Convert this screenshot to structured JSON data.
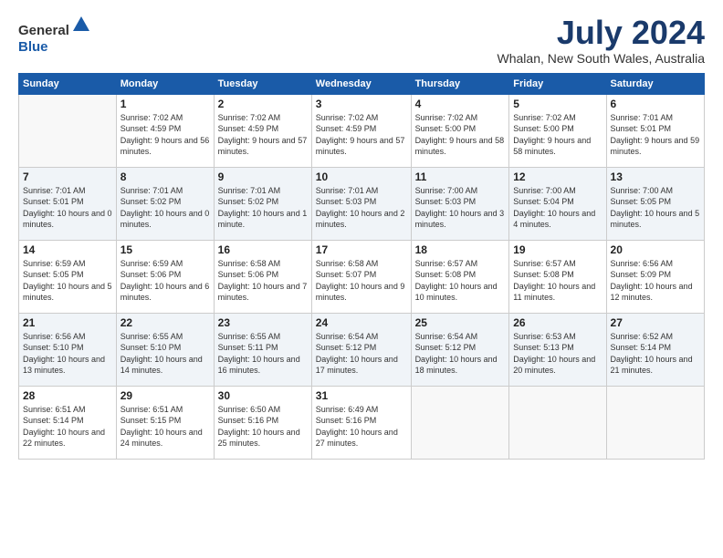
{
  "logo": {
    "general": "General",
    "blue": "Blue"
  },
  "title": "July 2024",
  "location": "Whalan, New South Wales, Australia",
  "weekdays": [
    "Sunday",
    "Monday",
    "Tuesday",
    "Wednesday",
    "Thursday",
    "Friday",
    "Saturday"
  ],
  "weeks": [
    [
      {
        "day": "",
        "sunrise": "",
        "sunset": "",
        "daylight": ""
      },
      {
        "day": "1",
        "sunrise": "Sunrise: 7:02 AM",
        "sunset": "Sunset: 4:59 PM",
        "daylight": "Daylight: 9 hours and 56 minutes."
      },
      {
        "day": "2",
        "sunrise": "Sunrise: 7:02 AM",
        "sunset": "Sunset: 4:59 PM",
        "daylight": "Daylight: 9 hours and 57 minutes."
      },
      {
        "day": "3",
        "sunrise": "Sunrise: 7:02 AM",
        "sunset": "Sunset: 4:59 PM",
        "daylight": "Daylight: 9 hours and 57 minutes."
      },
      {
        "day": "4",
        "sunrise": "Sunrise: 7:02 AM",
        "sunset": "Sunset: 5:00 PM",
        "daylight": "Daylight: 9 hours and 58 minutes."
      },
      {
        "day": "5",
        "sunrise": "Sunrise: 7:02 AM",
        "sunset": "Sunset: 5:00 PM",
        "daylight": "Daylight: 9 hours and 58 minutes."
      },
      {
        "day": "6",
        "sunrise": "Sunrise: 7:01 AM",
        "sunset": "Sunset: 5:01 PM",
        "daylight": "Daylight: 9 hours and 59 minutes."
      }
    ],
    [
      {
        "day": "7",
        "sunrise": "Sunrise: 7:01 AM",
        "sunset": "Sunset: 5:01 PM",
        "daylight": "Daylight: 10 hours and 0 minutes."
      },
      {
        "day": "8",
        "sunrise": "Sunrise: 7:01 AM",
        "sunset": "Sunset: 5:02 PM",
        "daylight": "Daylight: 10 hours and 0 minutes."
      },
      {
        "day": "9",
        "sunrise": "Sunrise: 7:01 AM",
        "sunset": "Sunset: 5:02 PM",
        "daylight": "Daylight: 10 hours and 1 minute."
      },
      {
        "day": "10",
        "sunrise": "Sunrise: 7:01 AM",
        "sunset": "Sunset: 5:03 PM",
        "daylight": "Daylight: 10 hours and 2 minutes."
      },
      {
        "day": "11",
        "sunrise": "Sunrise: 7:00 AM",
        "sunset": "Sunset: 5:03 PM",
        "daylight": "Daylight: 10 hours and 3 minutes."
      },
      {
        "day": "12",
        "sunrise": "Sunrise: 7:00 AM",
        "sunset": "Sunset: 5:04 PM",
        "daylight": "Daylight: 10 hours and 4 minutes."
      },
      {
        "day": "13",
        "sunrise": "Sunrise: 7:00 AM",
        "sunset": "Sunset: 5:05 PM",
        "daylight": "Daylight: 10 hours and 5 minutes."
      }
    ],
    [
      {
        "day": "14",
        "sunrise": "Sunrise: 6:59 AM",
        "sunset": "Sunset: 5:05 PM",
        "daylight": "Daylight: 10 hours and 5 minutes."
      },
      {
        "day": "15",
        "sunrise": "Sunrise: 6:59 AM",
        "sunset": "Sunset: 5:06 PM",
        "daylight": "Daylight: 10 hours and 6 minutes."
      },
      {
        "day": "16",
        "sunrise": "Sunrise: 6:58 AM",
        "sunset": "Sunset: 5:06 PM",
        "daylight": "Daylight: 10 hours and 7 minutes."
      },
      {
        "day": "17",
        "sunrise": "Sunrise: 6:58 AM",
        "sunset": "Sunset: 5:07 PM",
        "daylight": "Daylight: 10 hours and 9 minutes."
      },
      {
        "day": "18",
        "sunrise": "Sunrise: 6:57 AM",
        "sunset": "Sunset: 5:08 PM",
        "daylight": "Daylight: 10 hours and 10 minutes."
      },
      {
        "day": "19",
        "sunrise": "Sunrise: 6:57 AM",
        "sunset": "Sunset: 5:08 PM",
        "daylight": "Daylight: 10 hours and 11 minutes."
      },
      {
        "day": "20",
        "sunrise": "Sunrise: 6:56 AM",
        "sunset": "Sunset: 5:09 PM",
        "daylight": "Daylight: 10 hours and 12 minutes."
      }
    ],
    [
      {
        "day": "21",
        "sunrise": "Sunrise: 6:56 AM",
        "sunset": "Sunset: 5:10 PM",
        "daylight": "Daylight: 10 hours and 13 minutes."
      },
      {
        "day": "22",
        "sunrise": "Sunrise: 6:55 AM",
        "sunset": "Sunset: 5:10 PM",
        "daylight": "Daylight: 10 hours and 14 minutes."
      },
      {
        "day": "23",
        "sunrise": "Sunrise: 6:55 AM",
        "sunset": "Sunset: 5:11 PM",
        "daylight": "Daylight: 10 hours and 16 minutes."
      },
      {
        "day": "24",
        "sunrise": "Sunrise: 6:54 AM",
        "sunset": "Sunset: 5:12 PM",
        "daylight": "Daylight: 10 hours and 17 minutes."
      },
      {
        "day": "25",
        "sunrise": "Sunrise: 6:54 AM",
        "sunset": "Sunset: 5:12 PM",
        "daylight": "Daylight: 10 hours and 18 minutes."
      },
      {
        "day": "26",
        "sunrise": "Sunrise: 6:53 AM",
        "sunset": "Sunset: 5:13 PM",
        "daylight": "Daylight: 10 hours and 20 minutes."
      },
      {
        "day": "27",
        "sunrise": "Sunrise: 6:52 AM",
        "sunset": "Sunset: 5:14 PM",
        "daylight": "Daylight: 10 hours and 21 minutes."
      }
    ],
    [
      {
        "day": "28",
        "sunrise": "Sunrise: 6:51 AM",
        "sunset": "Sunset: 5:14 PM",
        "daylight": "Daylight: 10 hours and 22 minutes."
      },
      {
        "day": "29",
        "sunrise": "Sunrise: 6:51 AM",
        "sunset": "Sunset: 5:15 PM",
        "daylight": "Daylight: 10 hours and 24 minutes."
      },
      {
        "day": "30",
        "sunrise": "Sunrise: 6:50 AM",
        "sunset": "Sunset: 5:16 PM",
        "daylight": "Daylight: 10 hours and 25 minutes."
      },
      {
        "day": "31",
        "sunrise": "Sunrise: 6:49 AM",
        "sunset": "Sunset: 5:16 PM",
        "daylight": "Daylight: 10 hours and 27 minutes."
      },
      {
        "day": "",
        "sunrise": "",
        "sunset": "",
        "daylight": ""
      },
      {
        "day": "",
        "sunrise": "",
        "sunset": "",
        "daylight": ""
      },
      {
        "day": "",
        "sunrise": "",
        "sunset": "",
        "daylight": ""
      }
    ]
  ]
}
